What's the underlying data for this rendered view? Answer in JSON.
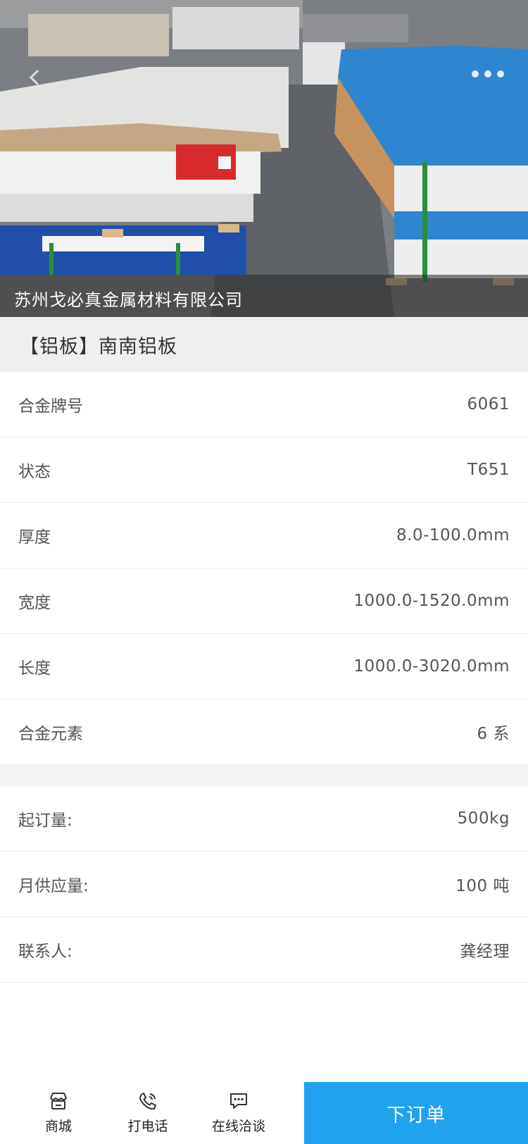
{
  "hero": {
    "company_name": "苏州戈必真金属材料有限公司"
  },
  "product": {
    "title": "【铝板】南南铝板"
  },
  "specs": [
    {
      "label": "合金牌号",
      "value": "6061"
    },
    {
      "label": "状态",
      "value": "T651"
    },
    {
      "label": "厚度",
      "value": "8.0-100.0mm"
    },
    {
      "label": "宽度",
      "value": "1000.0-1520.0mm"
    },
    {
      "label": "长度",
      "value": "1000.0-3020.0mm"
    },
    {
      "label": "合金元素",
      "value": "6 系"
    }
  ],
  "info": [
    {
      "label": "起订量:",
      "value": "500kg"
    },
    {
      "label": "月供应量:",
      "value": "100 吨"
    },
    {
      "label": "联系人:",
      "value": "龚经理"
    }
  ],
  "bottom_bar": {
    "tabs": [
      {
        "label": "商城",
        "icon": "store-icon"
      },
      {
        "label": "打电话",
        "icon": "phone-icon"
      },
      {
        "label": "在线洽谈",
        "icon": "chat-icon"
      }
    ],
    "order_label": "下订单"
  },
  "colors": {
    "accent": "#1fa3ee",
    "title_bar_bg": "#efefef"
  }
}
